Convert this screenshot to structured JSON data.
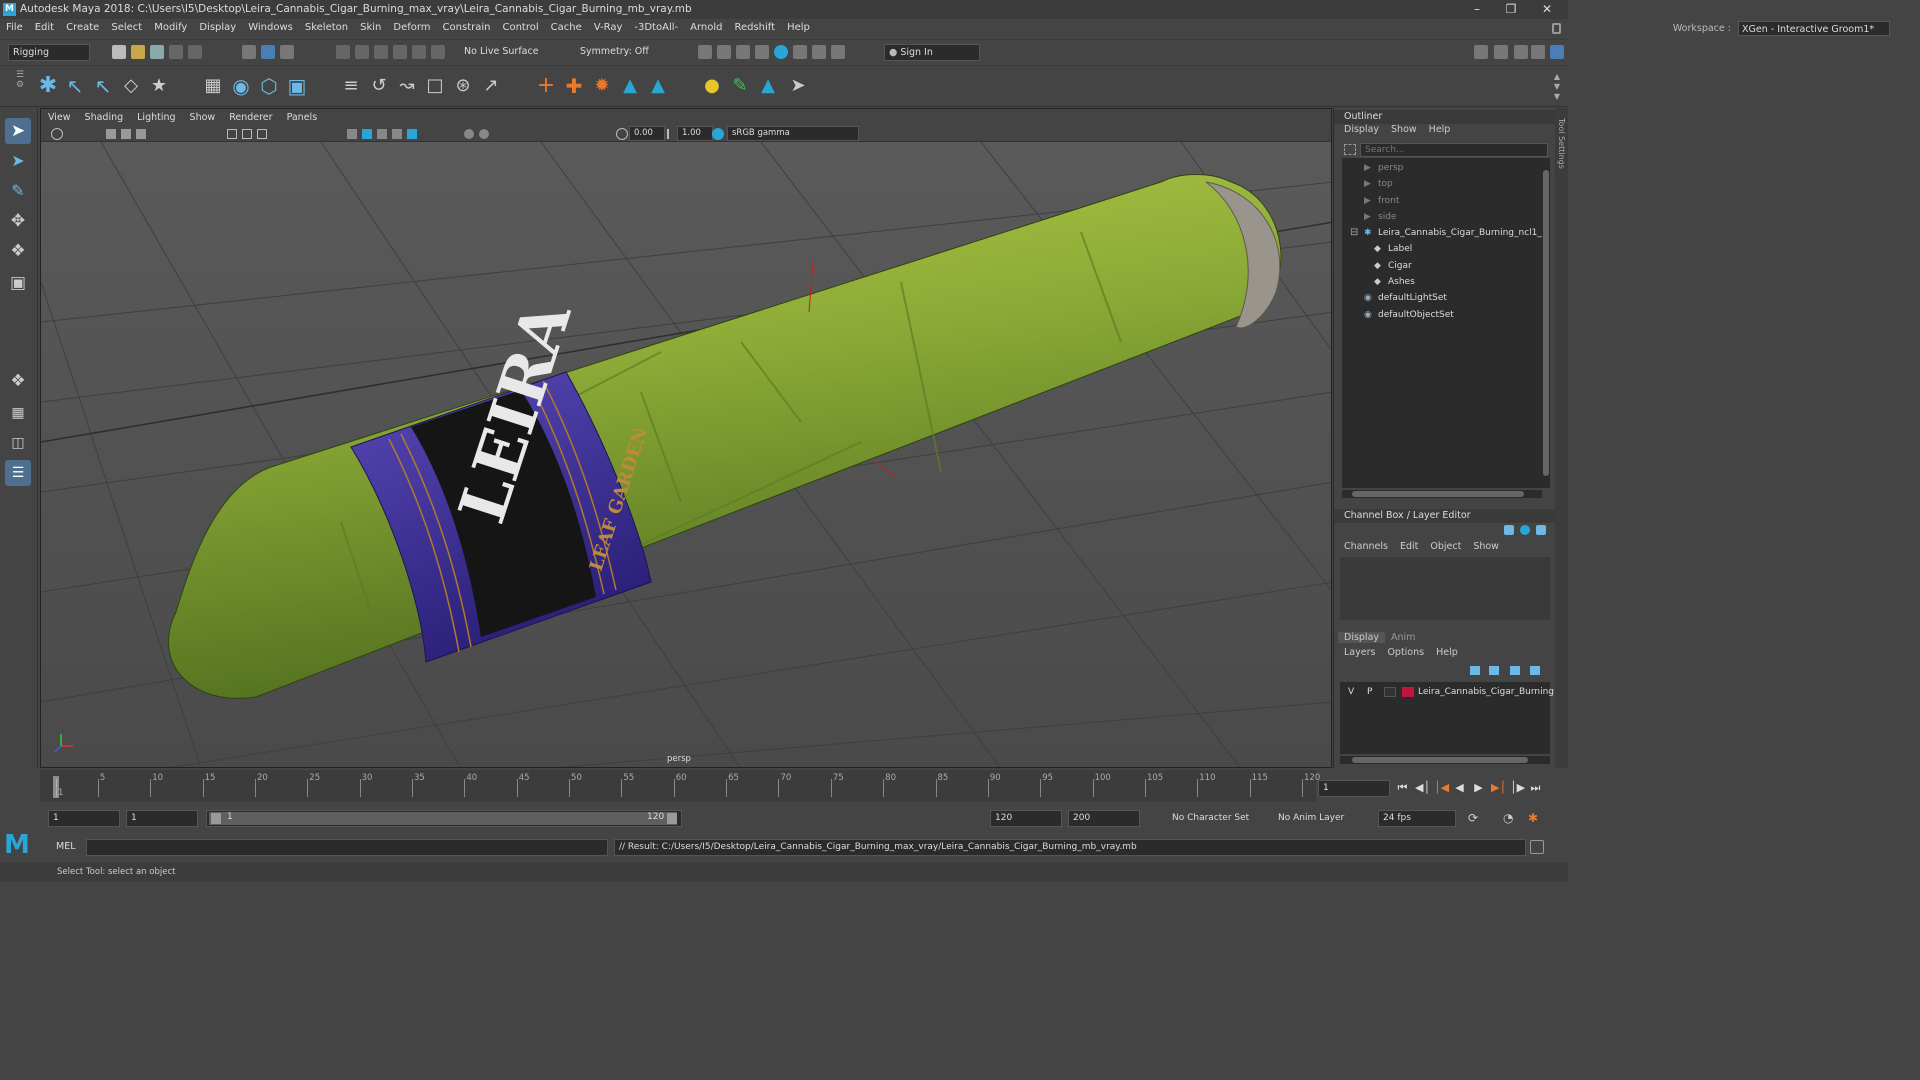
{
  "app": {
    "title": "Autodesk Maya 2018: C:\\Users\\I5\\Desktop\\Leira_Cannabis_Cigar_Burning_max_vray\\Leira_Cannabis_Cigar_Burning_mb_vray.mb",
    "logo_letter": "M"
  },
  "menu": [
    "File",
    "Edit",
    "Create",
    "Select",
    "Modify",
    "Display",
    "Windows",
    "Skeleton",
    "Skin",
    "Deform",
    "Constrain",
    "Control",
    "Cache",
    "V-Ray",
    "-3DtoAll-",
    "Arnold",
    "Redshift",
    "Help"
  ],
  "workspace": {
    "label": "Workspace :",
    "value": "XGen - Interactive Groom1*"
  },
  "status": {
    "mode": "Rigging",
    "live_surface": "No Live Surface",
    "symmetry": "Symmetry: Off",
    "sign_in": "Sign In"
  },
  "viewport": {
    "menu": [
      "View",
      "Shading",
      "Lighting",
      "Show",
      "Renderer",
      "Panels"
    ],
    "exposure": "0.00",
    "gamma": "1.00",
    "colorspace": "sRGB gamma",
    "camera": "persp",
    "label_text": "LEIRA",
    "band_text": "LEAF GARDEN"
  },
  "outliner": {
    "title": "Outliner",
    "menu": [
      "Display",
      "Show",
      "Help"
    ],
    "search_placeholder": "Search...",
    "items": [
      {
        "label": "persp",
        "dim": true,
        "indent": 1,
        "icon": "camera-icon"
      },
      {
        "label": "top",
        "dim": true,
        "indent": 1,
        "icon": "camera-icon"
      },
      {
        "label": "front",
        "dim": true,
        "indent": 1,
        "icon": "camera-icon"
      },
      {
        "label": "side",
        "dim": true,
        "indent": 1,
        "icon": "camera-icon"
      },
      {
        "label": "Leira_Cannabis_Cigar_Burning_ncl1_1",
        "dim": false,
        "indent": 1,
        "icon": "group-icon"
      },
      {
        "label": "Label",
        "dim": false,
        "indent": 2,
        "icon": "mesh-icon"
      },
      {
        "label": "Cigar",
        "dim": false,
        "indent": 2,
        "icon": "mesh-icon"
      },
      {
        "label": "Ashes",
        "dim": false,
        "indent": 2,
        "icon": "mesh-icon"
      },
      {
        "label": "defaultLightSet",
        "dim": false,
        "indent": 1,
        "icon": "set-icon"
      },
      {
        "label": "defaultObjectSet",
        "dim": false,
        "indent": 1,
        "icon": "set-icon"
      }
    ]
  },
  "channelbox": {
    "title": "Channel Box / Layer Editor",
    "menu": [
      "Channels",
      "Edit",
      "Object",
      "Show"
    ]
  },
  "layers": {
    "tabs": [
      "Display",
      "Anim"
    ],
    "menu": [
      "Layers",
      "Options",
      "Help"
    ],
    "row": {
      "v": "V",
      "p": "P",
      "name": "Leira_Cannabis_Cigar_Burning",
      "color": "#c0143c"
    }
  },
  "toolsettings": {
    "label": "Tool Settings"
  },
  "timeline": {
    "ticks": [
      1,
      5,
      10,
      15,
      20,
      25,
      30,
      35,
      40,
      45,
      50,
      55,
      60,
      65,
      70,
      75,
      80,
      85,
      90,
      95,
      100,
      105,
      110,
      115,
      120
    ],
    "current_frame": "1",
    "start": 1,
    "end": 120
  },
  "range": {
    "start": "1",
    "playback_start": "1",
    "slider_start": "1",
    "slider_end": "120",
    "playback_end": "120",
    "end": "200",
    "character_set": "No Character Set",
    "anim_layer": "No Anim Layer",
    "fps": "24 fps"
  },
  "command": {
    "lang": "MEL",
    "result": "// Result: C:/Users/I5/Desktop/Leira_Cannabis_Cigar_Burning_max_vray/Leira_Cannabis_Cigar_Burning_mb_vray.mb"
  },
  "help_line": "Select Tool: select an object",
  "colors": {
    "accent": "#2aa6d6",
    "panel": "#444444",
    "field": "#2b2b2b",
    "viewport_bg": "#535353"
  }
}
